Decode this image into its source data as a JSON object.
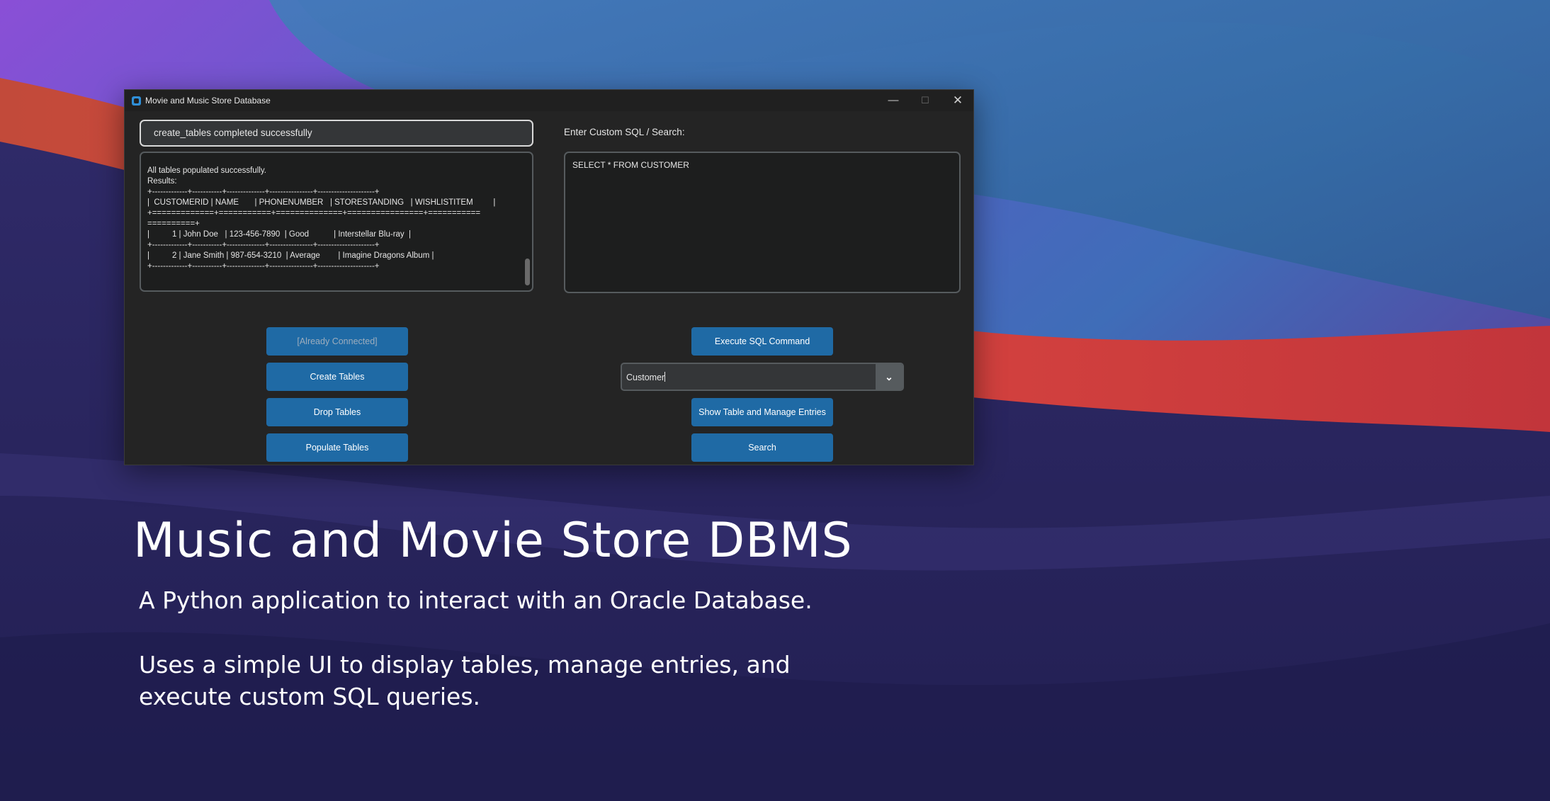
{
  "window": {
    "title": "Movie and Music Store Database",
    "controls": {
      "minimize": "—",
      "maximize": "☐",
      "close": "✕"
    }
  },
  "status_field": {
    "value": "create_tables completed successfully"
  },
  "output": {
    "text": "All tables populated successfully.\nResults:\n+-------------+-----------+--------------+----------------+---------------------+\n|  CUSTOMERID | NAME       | PHONENUMBER   | STORESTANDING   | WISHLISTITEM         |\n+=============+===========+==============+================+===========\n==========+\n|          1 | John Doe   | 123-456-7890  | Good           | Interstellar Blu-ray  |\n+-------------+-----------+--------------+----------------+---------------------+\n|          2 | Jane Smith | 987-654-3210  | Average        | Imagine Dragons Album |\n+-------------+-----------+--------------+----------------+---------------------+"
  },
  "sql": {
    "label": "Enter Custom SQL / Search:",
    "value": "SELECT * FROM CUSTOMER"
  },
  "buttons": {
    "connect": "[Already Connected]",
    "create_tables": "Create Tables",
    "drop_tables": "Drop Tables",
    "populate_tables": "Populate Tables",
    "execute_sql": "Execute SQL Command",
    "show_table": "Show Table and Manage Entries",
    "search": "Search"
  },
  "table_select": {
    "value": "Customer",
    "arrow": "⌄"
  },
  "hero": {
    "title": "Music and Movie Store DBMS",
    "subtitle": "A Python application to interact with an Oracle Database.",
    "description": "Uses a simple UI to display tables, manage entries, and execute custom SQL queries."
  },
  "colors": {
    "accent_button": "#1f6aa5",
    "window_bg": "#242424",
    "field_bg": "#343638"
  }
}
